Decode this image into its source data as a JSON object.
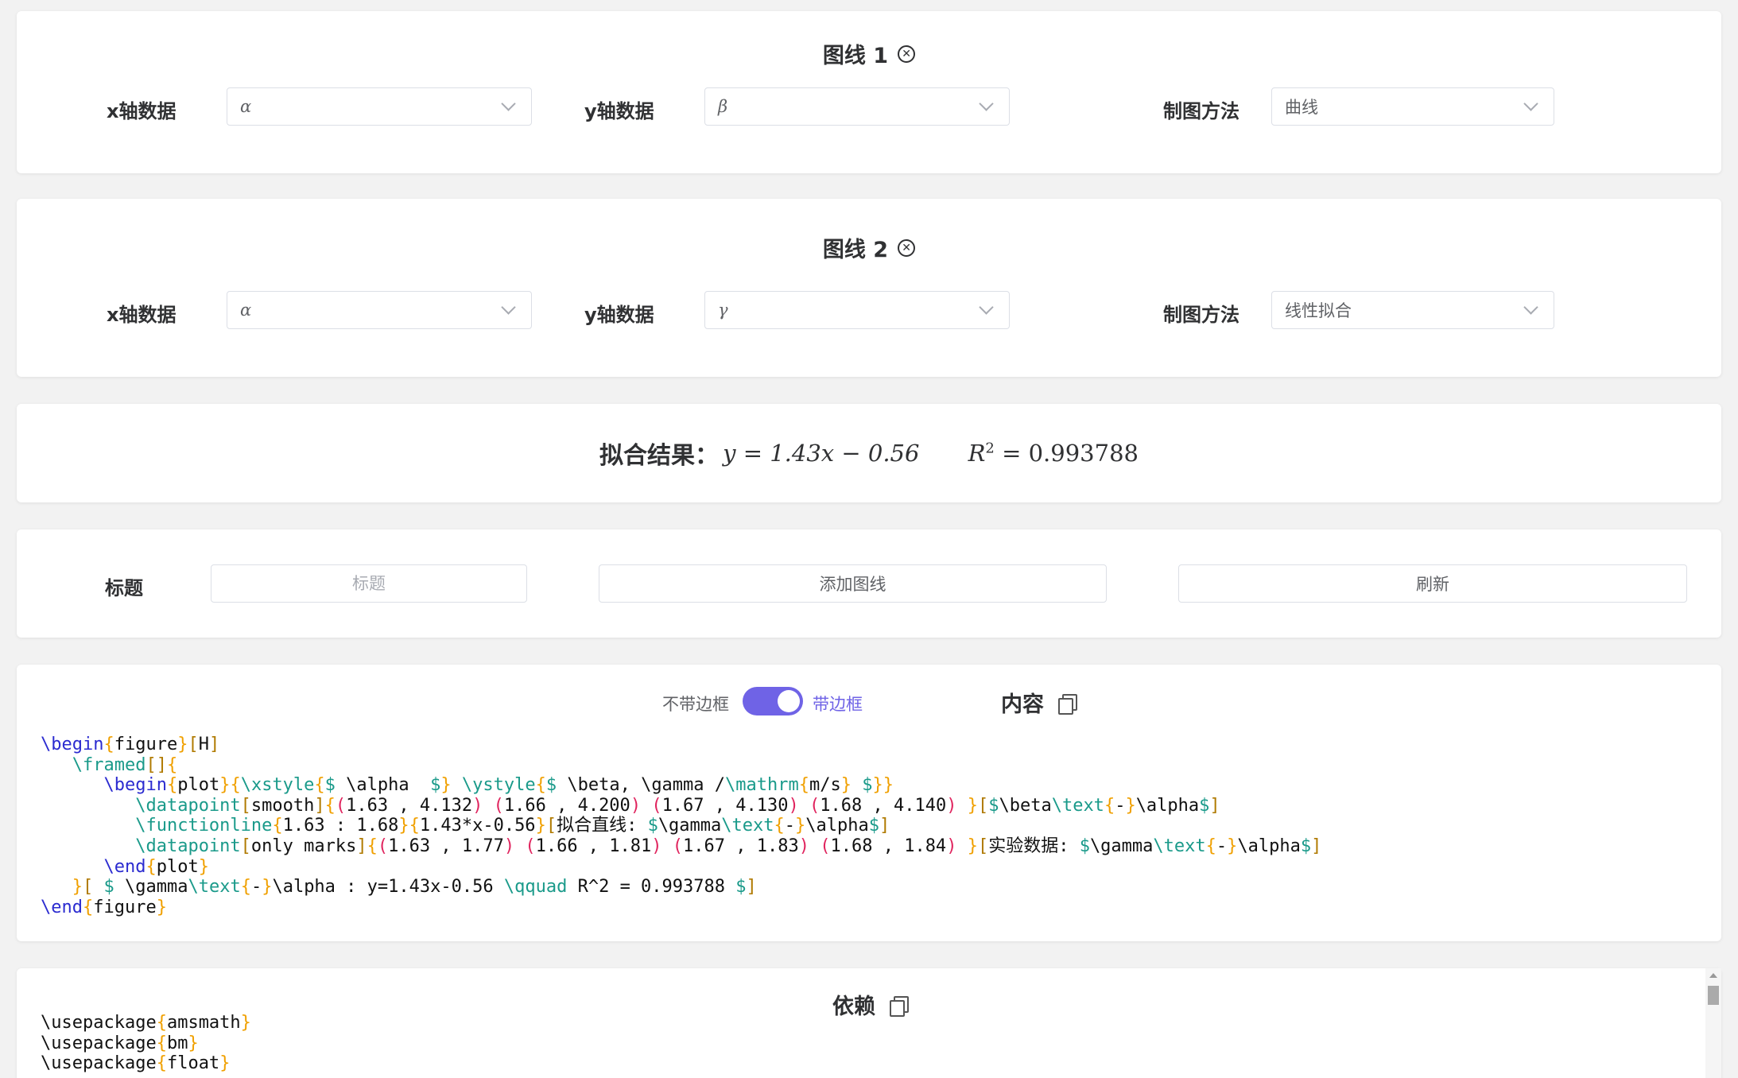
{
  "series": [
    {
      "title": "图线 1",
      "x_label": "x轴数据",
      "x_value": "α",
      "y_label": "y轴数据",
      "y_value": "β",
      "method_label": "制图方法",
      "method_value": "曲线"
    },
    {
      "title": "图线 2",
      "x_label": "x轴数据",
      "x_value": "α",
      "y_label": "y轴数据",
      "y_value": "γ",
      "method_label": "制图方法",
      "method_value": "线性拟合"
    }
  ],
  "fit": {
    "label": "拟合结果：",
    "equation": "y = 1.43x − 0.56",
    "r2_symbol": "R",
    "r2_exp": "2",
    "r2_value": " = 0.993788"
  },
  "controls": {
    "title_label": "标题",
    "title_placeholder": "标题",
    "add_button": "添加图线",
    "refresh_button": "刷新"
  },
  "content": {
    "switch_off_label": "不带边框",
    "switch_on_label": "带边框",
    "switch_on": true,
    "title": "内容",
    "code": {
      "l1a": "\\begin",
      "l1b": "figure",
      "l1c": "H",
      "l2a": "\\framed",
      "l3a": "\\begin",
      "l3b": "plot",
      "l3c": "\\xstyle",
      "l3d": " \\alpha  ",
      "l3e": "\\ystyle",
      "l3f": " \\beta, \\gamma /",
      "l3g": "\\mathrm",
      "l3h": "m/s",
      "l4a": "\\datapoint",
      "l4b": "smooth",
      "l4c": "1.63 , 4.132",
      "l4d": "1.66 , 4.200",
      "l4e": "1.67 , 4.130",
      "l4f": "1.68 , 4.140",
      "l4g": "\\beta",
      "l4h": "\\text",
      "l4i": "-",
      "l4j": "\\alpha",
      "l5a": "\\functionline",
      "l5b": "1.63 : 1.68",
      "l5c": "1.43*x-0.56",
      "l5d": "拟合直线: ",
      "l5e": "\\gamma",
      "l5f": "\\text",
      "l5g": "-",
      "l5h": "\\alpha",
      "l6a": "\\datapoint",
      "l6b": "only marks",
      "l6c": "1.63 , 1.77",
      "l6d": "1.66 , 1.81",
      "l6e": "1.67 , 1.83",
      "l6f": "1.68 , 1.84",
      "l6g": "实验数据: ",
      "l6h": "\\gamma",
      "l6i": "\\text",
      "l6j": "-",
      "l6k": "\\alpha",
      "l7a": "\\end",
      "l7b": "plot",
      "l8a": " \\gamma",
      "l8b": "\\text",
      "l8c": "-",
      "l8d": "\\alpha : y=1.43x-0.56 ",
      "l8e": "\\qquad",
      "l8f": " R^2 = 0.993788 ",
      "l9a": "\\end",
      "l9b": "figure"
    }
  },
  "deps": {
    "title": "依赖",
    "lines": [
      "amsmath",
      "bm",
      "float"
    ],
    "cmd": "\\usepackage"
  }
}
